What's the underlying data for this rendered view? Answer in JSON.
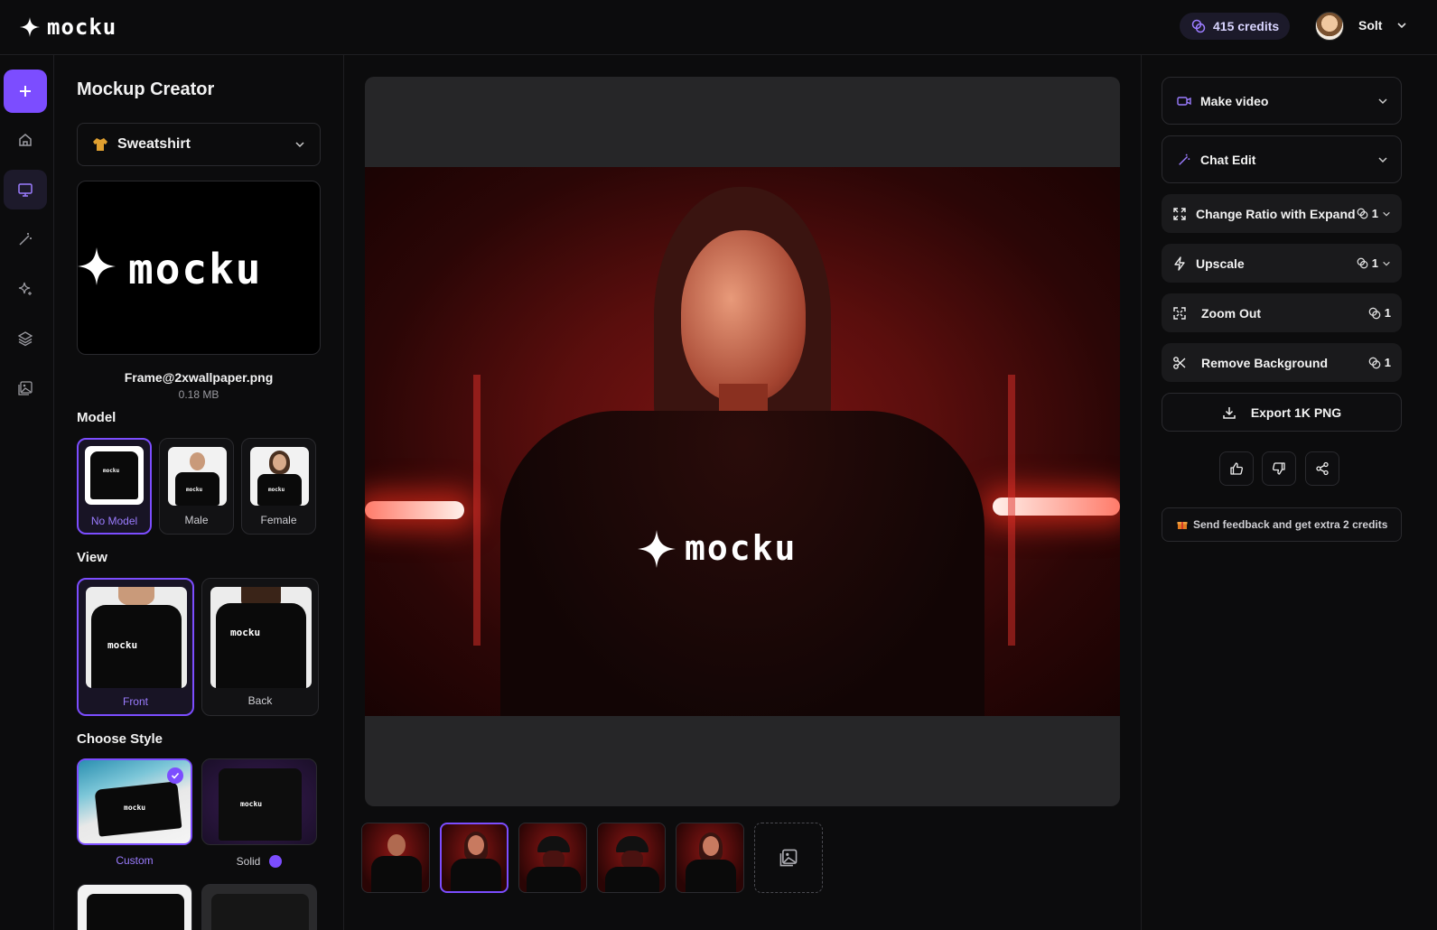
{
  "app": {
    "logo_text": "mocku",
    "credits_label": "415 credits",
    "user_name": "Solt"
  },
  "left_panel": {
    "title": "Mockup Creator",
    "product_select": {
      "value": "Sweatshirt",
      "icon": "sweatshirt-icon"
    },
    "upload": {
      "file_name": "Frame@2xwallpaper.png",
      "file_size": "0.18 MB",
      "preview_text": "mocku"
    },
    "model": {
      "label": "Model",
      "options": [
        {
          "label": "No Model",
          "selected": true
        },
        {
          "label": "Male",
          "selected": false
        },
        {
          "label": "Female",
          "selected": false
        }
      ]
    },
    "view": {
      "label": "View",
      "options": [
        {
          "label": "Front",
          "selected": true
        },
        {
          "label": "Back",
          "selected": false
        }
      ]
    },
    "style": {
      "label": "Choose Style",
      "options": [
        {
          "label": "Custom",
          "selected": true
        },
        {
          "label": "Solid",
          "selected": false,
          "swatch_color": "#7c4dff"
        }
      ]
    }
  },
  "canvas": {
    "brand_text": "mocku",
    "thumbnails": [
      {
        "subject": "male",
        "selected": false
      },
      {
        "subject": "female",
        "selected": true
      },
      {
        "subject": "cap",
        "selected": false
      },
      {
        "subject": "cap",
        "selected": false
      },
      {
        "subject": "female",
        "selected": false
      }
    ]
  },
  "right_panel": {
    "actions": [
      {
        "label": "Make video",
        "icon": "video-icon",
        "kind": "dropdown"
      },
      {
        "label": "Chat Edit",
        "icon": "magic-wand-icon",
        "kind": "dropdown"
      },
      {
        "label": "Change Ratio with Expand",
        "icon": "expand-icon",
        "cost": "1",
        "kind": "cost-dropdown"
      },
      {
        "label": "Upscale",
        "icon": "bolt-icon",
        "cost": "1",
        "kind": "cost-dropdown"
      },
      {
        "label": "Zoom Out",
        "icon": "zoom-out-icon",
        "cost": "1",
        "kind": "cost"
      },
      {
        "label": "Remove Background",
        "icon": "scissors-icon",
        "cost": "1",
        "kind": "cost"
      }
    ],
    "export_label": "Export 1K PNG",
    "feedback_text": "Send feedback and get extra 2 credits"
  },
  "colors": {
    "accent": "#7c4dff",
    "background": "#0c0c0d",
    "panel_border": "#1f1f22"
  }
}
